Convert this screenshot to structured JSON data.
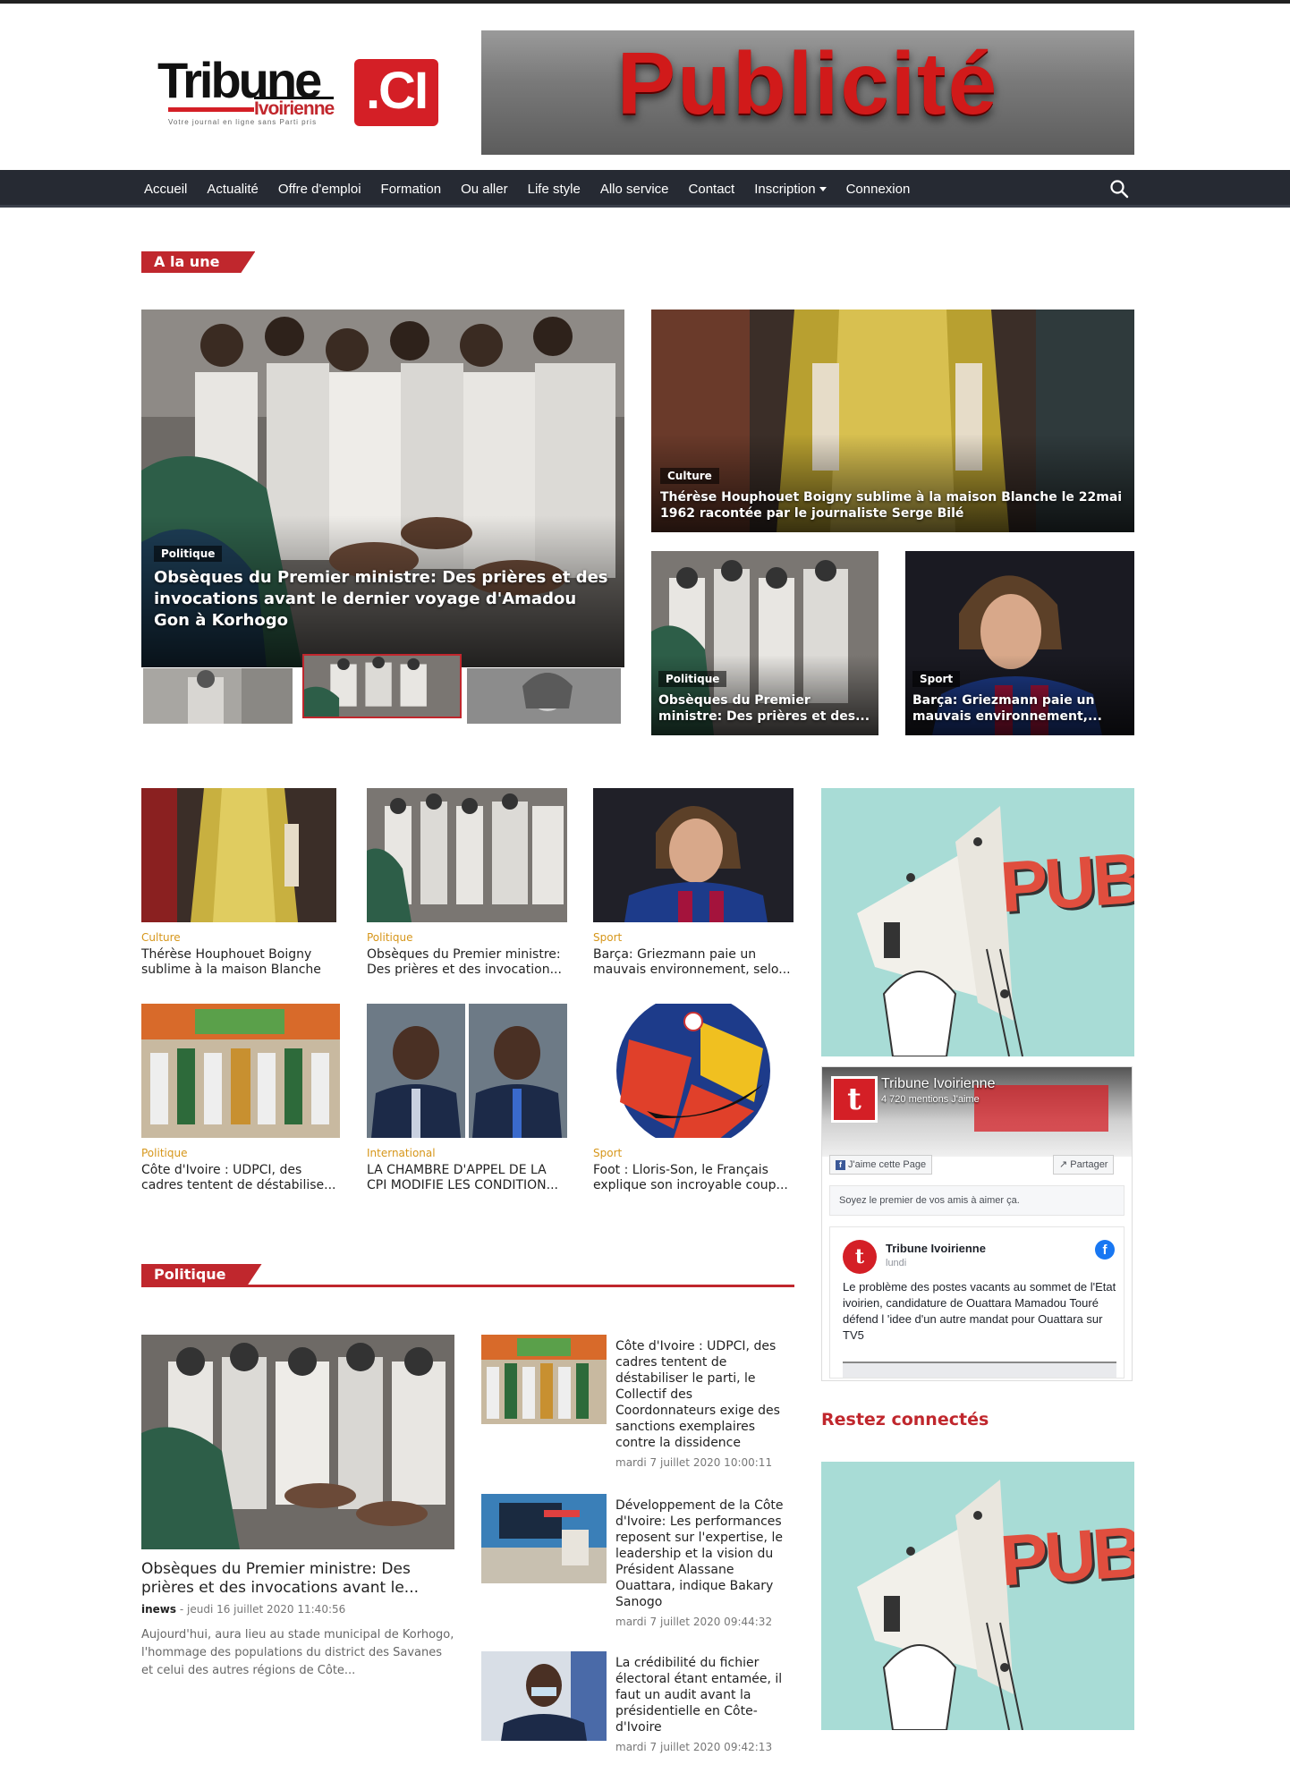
{
  "header": {
    "logo_word": "Tribune",
    "logo_sub": "Ivoirienne",
    "logo_ci": ".CI",
    "logo_tagline": "Votre journal en ligne sans Parti pris",
    "banner_text": "Publicité"
  },
  "nav": {
    "items": [
      "Accueil",
      "Actualité",
      "Offre d'emploi",
      "Formation",
      "Ou aller",
      "Life style",
      "Allo service",
      "Contact",
      "Inscription",
      "Connexion"
    ],
    "search_icon": "search-icon",
    "bg_color": "#262a33"
  },
  "a_la_une": {
    "heading": "A la une",
    "main": {
      "category": "Politique",
      "title": "Obsèques du Premier ministre: Des prières et des invocations avant le dernier voyage d'Amadou Gon à Korhogo"
    },
    "top_right": {
      "category": "Culture",
      "title": "Thérèse Houphouet Boigny sublime à la maison Blanche le 22mai 1962 racontée par le journaliste Serge Bilé"
    },
    "small_left": {
      "category": "Politique",
      "title": "Obsèques du Premier ministre: Des prières et des..."
    },
    "small_right": {
      "category": "Sport",
      "title": "Barça: Griezmann paie un mauvais environnement,..."
    }
  },
  "grid": [
    {
      "category": "Culture",
      "title": "Thérèse Houphouet Boigny sublime à la maison Blanche ..."
    },
    {
      "category": "Politique",
      "title": "Obsèques du Premier ministre: Des prières et des invocation..."
    },
    {
      "category": "Sport",
      "title": "Barça: Griezmann paie un mauvais environnement, selo..."
    },
    {
      "category": "Politique",
      "title": "Côte d'Ivoire : UDPCI, des cadres tentent de déstabilise..."
    },
    {
      "category": "International",
      "title": "LA CHAMBRE D'APPEL DE LA CPI MODIFIE LES CONDITION..."
    },
    {
      "category": "Sport",
      "title": "Foot : Lloris-Son, le Français explique son incroyable coup..."
    }
  ],
  "sidebar": {
    "pub_text": "PUB",
    "fb": {
      "page_name": "Tribune Ivoirienne",
      "likes": "4 720 mentions J'aime",
      "like_button": "J'aime cette Page",
      "share_button": "Partager",
      "friends_text": "Soyez le premier de vos amis à aimer ça.",
      "post_author": "Tribune Ivoirienne",
      "post_time": "lundi",
      "post_text": "Le problème des postes vacants au sommet de l'Etat ivoirien, candidature de Ouattara Mamadou Touré défend l 'idee d'un autre mandat pour Ouattara sur TV5"
    },
    "restez": "Restez connectés"
  },
  "politique": {
    "heading": "Politique",
    "feature": {
      "title": "Obsèques du Premier ministre: Des prières et des invocations avant le...",
      "author": "inews",
      "date": "jeudi 16 juillet 2020 11:40:56",
      "excerpt": "Aujourd'hui, aura lieu au stade municipal de Korhogo, l'hommage des populations du district des Savanes et celui des autres régions de Côte..."
    },
    "list": [
      {
        "title": "Côte d'Ivoire : UDPCI, des cadres tentent de déstabiliser le parti, le Collectif des Coordonnateurs exige des sanctions exemplaires contre la dissidence",
        "date": "mardi 7 juillet 2020 10:00:11"
      },
      {
        "title": "Développement de la Côte d'Ivoire: Les performances reposent sur l'expertise, le leadership et la vision du Président Alassane Ouattara, indique Bakary Sanogo",
        "date": "mardi 7 juillet 2020 09:44:32"
      },
      {
        "title": "La crédibilité du fichier électoral étant entamée, il faut un audit avant la présidentielle en Côte-d'Ivoire",
        "date": "mardi 7 juillet 2020 09:42:13"
      }
    ]
  },
  "colors": {
    "accent": "#c0272d",
    "category": "#d6961a"
  }
}
